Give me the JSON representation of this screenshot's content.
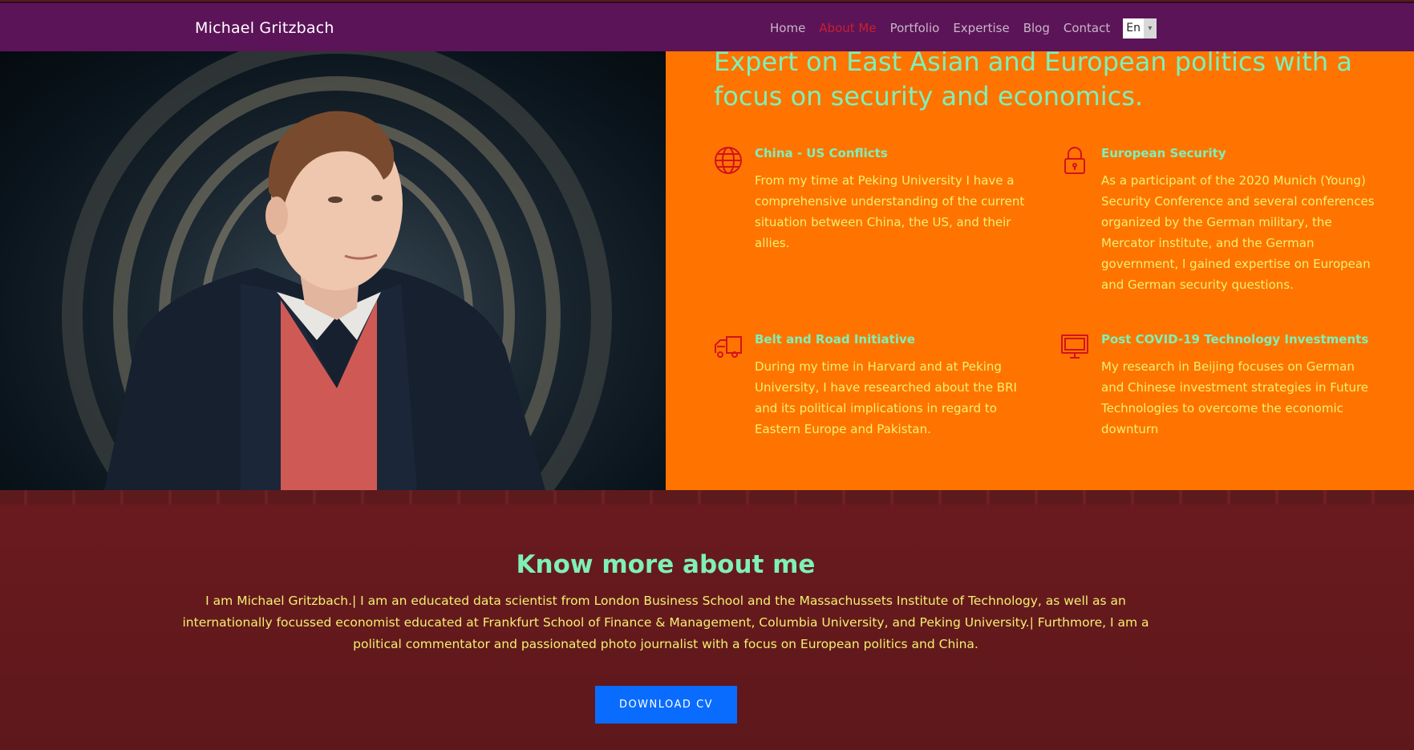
{
  "navbar": {
    "brand": "Michael Gritzbach",
    "links": [
      {
        "label": "Home",
        "active": false
      },
      {
        "label": "About Me",
        "active": true
      },
      {
        "label": "Portfolio",
        "active": false
      },
      {
        "label": "Expertise",
        "active": false
      },
      {
        "label": "Blog",
        "active": false
      },
      {
        "label": "Contact",
        "active": false
      }
    ],
    "language": {
      "selected": "En"
    }
  },
  "hero": {
    "headline": "Expert on East Asian and European politics with a focus on security and economics.",
    "features": [
      {
        "icon": "globe-icon",
        "title": "China - US Conflicts",
        "text": "From my time at Peking University I have a comprehensive understanding of the current situation between China, the US, and their allies."
      },
      {
        "icon": "lock-icon",
        "title": "European Security",
        "text": "As a participant of the 2020 Munich (Young) Security Conference and several conferences organized by the German military, the Mercator institute, and the German government, I gained expertise on European and German security questions."
      },
      {
        "icon": "truck-icon",
        "title": "Belt and Road Initiative",
        "text": "During my time in Harvard and at Peking University, I have researched about the BRI and its political implications in regard to Eastern Europe and Pakistan."
      },
      {
        "icon": "monitor-icon",
        "title": "Post COVID-19 Technology Investments",
        "text": "My research in Beijing focuses on German and Chinese investment strategies in Future Technologies to overcome the economic downturn"
      }
    ]
  },
  "about": {
    "title": "Know more about me",
    "text": "I am Michael Gritzbach.| I am an educated data scientist from London Business School and the Massachussets Institute of Technology, as well as an internationally focussed economist educated at Frankfurt School of Finance & Management, Columbia University, and Peking University.| Furthmore, I am a political commentator and passionated photo journalist with a focus on European politics and China.",
    "button_label": "DOWNLOAD CV"
  },
  "colors": {
    "navbar_bg": "#5c1459",
    "nav_active": "#c8202d",
    "hero_right_bg": "#ff7400",
    "accent_mint": "#7ef0b8",
    "accent_yellow": "#f3f070",
    "icon_red": "#d4121e",
    "about_bg": "#5e181b",
    "button_bg": "#0a6cff"
  }
}
